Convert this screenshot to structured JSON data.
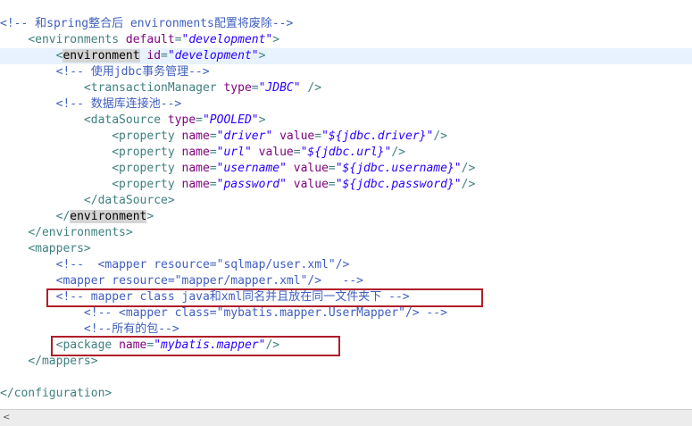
{
  "lines": [
    {
      "indent": "",
      "parts": [
        [
          "cm",
          "<!-- 和spring整合后 environments配置将废除-->"
        ]
      ]
    },
    {
      "indent": "    ",
      "parts": [
        [
          "tag",
          "<environments "
        ],
        [
          "attr",
          "default"
        ],
        [
          "tag",
          "="
        ],
        [
          "val",
          "\"development\""
        ],
        [
          "tag",
          ">"
        ]
      ]
    },
    {
      "indent": "        ",
      "current": true,
      "parts": [
        [
          "tag",
          "<"
        ],
        [
          "hl",
          "environment"
        ],
        [
          "tag",
          " "
        ],
        [
          "attr",
          "id"
        ],
        [
          "tag",
          "="
        ],
        [
          "val",
          "\"development\""
        ],
        [
          "tag",
          ">"
        ]
      ]
    },
    {
      "indent": "        ",
      "parts": [
        [
          "cm",
          "<!-- 使用jdbc事务管理-->"
        ]
      ]
    },
    {
      "indent": "            ",
      "parts": [
        [
          "tag",
          "<transactionManager "
        ],
        [
          "attr",
          "type"
        ],
        [
          "tag",
          "="
        ],
        [
          "val",
          "\"JDBC\""
        ],
        [
          "tag",
          " />"
        ]
      ]
    },
    {
      "indent": "        ",
      "parts": [
        [
          "cm",
          "<!-- 数据库连接池-->"
        ]
      ]
    },
    {
      "indent": "            ",
      "parts": [
        [
          "tag",
          "<dataSource "
        ],
        [
          "attr",
          "type"
        ],
        [
          "tag",
          "="
        ],
        [
          "val",
          "\"POOLED\""
        ],
        [
          "tag",
          ">"
        ]
      ]
    },
    {
      "indent": "                ",
      "parts": [
        [
          "tag",
          "<property "
        ],
        [
          "attr",
          "name"
        ],
        [
          "tag",
          "="
        ],
        [
          "val",
          "\"driver\""
        ],
        [
          "tag",
          " "
        ],
        [
          "attr",
          "value"
        ],
        [
          "tag",
          "="
        ],
        [
          "val",
          "\"${jdbc.driver}\""
        ],
        [
          "tag",
          "/>"
        ]
      ]
    },
    {
      "indent": "                ",
      "parts": [
        [
          "tag",
          "<property "
        ],
        [
          "attr",
          "name"
        ],
        [
          "tag",
          "="
        ],
        [
          "val",
          "\"url\""
        ],
        [
          "tag",
          " "
        ],
        [
          "attr",
          "value"
        ],
        [
          "tag",
          "="
        ],
        [
          "val",
          "\"${jdbc.url}\""
        ],
        [
          "tag",
          "/>"
        ]
      ]
    },
    {
      "indent": "                ",
      "parts": [
        [
          "tag",
          "<property "
        ],
        [
          "attr",
          "name"
        ],
        [
          "tag",
          "="
        ],
        [
          "val",
          "\"username\""
        ],
        [
          "tag",
          " "
        ],
        [
          "attr",
          "value"
        ],
        [
          "tag",
          "="
        ],
        [
          "val",
          "\"${jdbc.username}\""
        ],
        [
          "tag",
          "/>"
        ]
      ]
    },
    {
      "indent": "                ",
      "parts": [
        [
          "tag",
          "<property "
        ],
        [
          "attr",
          "name"
        ],
        [
          "tag",
          "="
        ],
        [
          "val",
          "\"password\""
        ],
        [
          "tag",
          " "
        ],
        [
          "attr",
          "value"
        ],
        [
          "tag",
          "="
        ],
        [
          "val",
          "\"${jdbc.password}\""
        ],
        [
          "tag",
          "/>"
        ]
      ]
    },
    {
      "indent": "            ",
      "parts": [
        [
          "tag",
          "</dataSource>"
        ]
      ]
    },
    {
      "indent": "        ",
      "parts": [
        [
          "tag",
          "</"
        ],
        [
          "hl",
          "environment"
        ],
        [
          "tag",
          ">"
        ]
      ]
    },
    {
      "indent": "    ",
      "parts": [
        [
          "tag",
          "</environments>"
        ]
      ]
    },
    {
      "indent": "    ",
      "parts": [
        [
          "tag",
          "<mappers>"
        ]
      ]
    },
    {
      "indent": "        ",
      "parts": [
        [
          "cm",
          "<!--  <mapper resource=\"sqlmap/user.xml\"/>"
        ]
      ]
    },
    {
      "indent": "        ",
      "parts": [
        [
          "cm",
          "<mapper resource=\"mapper/mapper.xml\"/>   -->"
        ]
      ]
    },
    {
      "indent": "        ",
      "parts": [
        [
          "cm",
          "<!-- mapper class java和xml同名并且放在同一文件夹下 -->"
        ]
      ]
    },
    {
      "indent": "            ",
      "parts": [
        [
          "cm",
          "<!-- <mapper class=\"mybatis.mapper.UserMapper\"/> -->"
        ]
      ]
    },
    {
      "indent": "            ",
      "parts": [
        [
          "cm",
          "<!--所有的包-->"
        ]
      ]
    },
    {
      "indent": "        ",
      "parts": [
        [
          "tag",
          "<package "
        ],
        [
          "attr",
          "name"
        ],
        [
          "tag",
          "="
        ],
        [
          "val",
          "\"mybatis.mapper\""
        ],
        [
          "tag",
          "/>"
        ]
      ]
    },
    {
      "indent": "    ",
      "parts": [
        [
          "tag",
          "</mappers>"
        ]
      ]
    },
    {
      "indent": "",
      "parts": [
        [
          "tag",
          ""
        ]
      ]
    },
    {
      "indent": "",
      "parts": [
        [
          "tag",
          "</configuration>"
        ]
      ]
    }
  ],
  "scrollbar": {
    "arrow_icon": "chevron-left-icon",
    "arrow_glyph": "<"
  },
  "colors": {
    "tag": "#3f7f7f",
    "attr": "#7f007f",
    "value": "#2a00ff",
    "comment": "#3f5fbf",
    "highlight_box": "#b01c2a"
  }
}
